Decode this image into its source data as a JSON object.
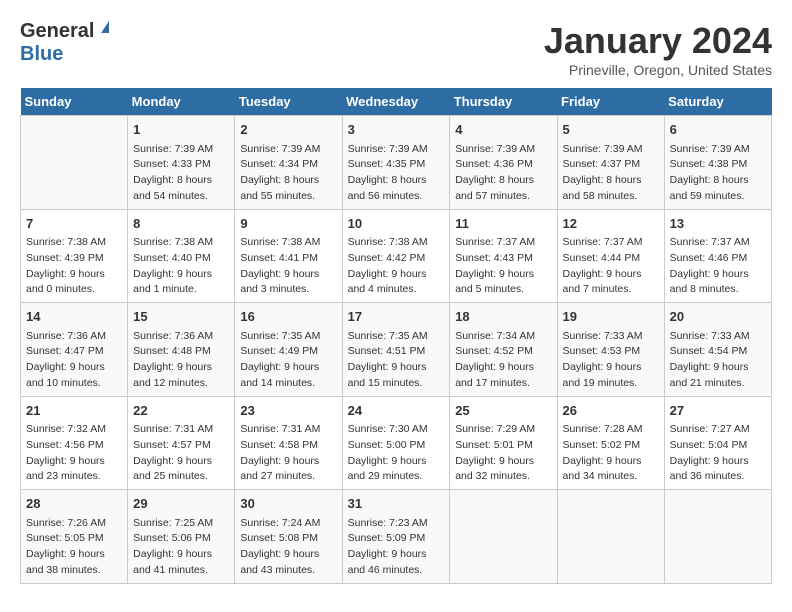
{
  "header": {
    "logo_general": "General",
    "logo_blue": "Blue",
    "month": "January 2024",
    "location": "Prineville, Oregon, United States"
  },
  "days_of_week": [
    "Sunday",
    "Monday",
    "Tuesday",
    "Wednesday",
    "Thursday",
    "Friday",
    "Saturday"
  ],
  "weeks": [
    [
      {
        "day": "",
        "info": ""
      },
      {
        "day": "1",
        "info": "Sunrise: 7:39 AM\nSunset: 4:33 PM\nDaylight: 8 hours\nand 54 minutes."
      },
      {
        "day": "2",
        "info": "Sunrise: 7:39 AM\nSunset: 4:34 PM\nDaylight: 8 hours\nand 55 minutes."
      },
      {
        "day": "3",
        "info": "Sunrise: 7:39 AM\nSunset: 4:35 PM\nDaylight: 8 hours\nand 56 minutes."
      },
      {
        "day": "4",
        "info": "Sunrise: 7:39 AM\nSunset: 4:36 PM\nDaylight: 8 hours\nand 57 minutes."
      },
      {
        "day": "5",
        "info": "Sunrise: 7:39 AM\nSunset: 4:37 PM\nDaylight: 8 hours\nand 58 minutes."
      },
      {
        "day": "6",
        "info": "Sunrise: 7:39 AM\nSunset: 4:38 PM\nDaylight: 8 hours\nand 59 minutes."
      }
    ],
    [
      {
        "day": "7",
        "info": "Sunrise: 7:38 AM\nSunset: 4:39 PM\nDaylight: 9 hours\nand 0 minutes."
      },
      {
        "day": "8",
        "info": "Sunrise: 7:38 AM\nSunset: 4:40 PM\nDaylight: 9 hours\nand 1 minute."
      },
      {
        "day": "9",
        "info": "Sunrise: 7:38 AM\nSunset: 4:41 PM\nDaylight: 9 hours\nand 3 minutes."
      },
      {
        "day": "10",
        "info": "Sunrise: 7:38 AM\nSunset: 4:42 PM\nDaylight: 9 hours\nand 4 minutes."
      },
      {
        "day": "11",
        "info": "Sunrise: 7:37 AM\nSunset: 4:43 PM\nDaylight: 9 hours\nand 5 minutes."
      },
      {
        "day": "12",
        "info": "Sunrise: 7:37 AM\nSunset: 4:44 PM\nDaylight: 9 hours\nand 7 minutes."
      },
      {
        "day": "13",
        "info": "Sunrise: 7:37 AM\nSunset: 4:46 PM\nDaylight: 9 hours\nand 8 minutes."
      }
    ],
    [
      {
        "day": "14",
        "info": "Sunrise: 7:36 AM\nSunset: 4:47 PM\nDaylight: 9 hours\nand 10 minutes."
      },
      {
        "day": "15",
        "info": "Sunrise: 7:36 AM\nSunset: 4:48 PM\nDaylight: 9 hours\nand 12 minutes."
      },
      {
        "day": "16",
        "info": "Sunrise: 7:35 AM\nSunset: 4:49 PM\nDaylight: 9 hours\nand 14 minutes."
      },
      {
        "day": "17",
        "info": "Sunrise: 7:35 AM\nSunset: 4:51 PM\nDaylight: 9 hours\nand 15 minutes."
      },
      {
        "day": "18",
        "info": "Sunrise: 7:34 AM\nSunset: 4:52 PM\nDaylight: 9 hours\nand 17 minutes."
      },
      {
        "day": "19",
        "info": "Sunrise: 7:33 AM\nSunset: 4:53 PM\nDaylight: 9 hours\nand 19 minutes."
      },
      {
        "day": "20",
        "info": "Sunrise: 7:33 AM\nSunset: 4:54 PM\nDaylight: 9 hours\nand 21 minutes."
      }
    ],
    [
      {
        "day": "21",
        "info": "Sunrise: 7:32 AM\nSunset: 4:56 PM\nDaylight: 9 hours\nand 23 minutes."
      },
      {
        "day": "22",
        "info": "Sunrise: 7:31 AM\nSunset: 4:57 PM\nDaylight: 9 hours\nand 25 minutes."
      },
      {
        "day": "23",
        "info": "Sunrise: 7:31 AM\nSunset: 4:58 PM\nDaylight: 9 hours\nand 27 minutes."
      },
      {
        "day": "24",
        "info": "Sunrise: 7:30 AM\nSunset: 5:00 PM\nDaylight: 9 hours\nand 29 minutes."
      },
      {
        "day": "25",
        "info": "Sunrise: 7:29 AM\nSunset: 5:01 PM\nDaylight: 9 hours\nand 32 minutes."
      },
      {
        "day": "26",
        "info": "Sunrise: 7:28 AM\nSunset: 5:02 PM\nDaylight: 9 hours\nand 34 minutes."
      },
      {
        "day": "27",
        "info": "Sunrise: 7:27 AM\nSunset: 5:04 PM\nDaylight: 9 hours\nand 36 minutes."
      }
    ],
    [
      {
        "day": "28",
        "info": "Sunrise: 7:26 AM\nSunset: 5:05 PM\nDaylight: 9 hours\nand 38 minutes."
      },
      {
        "day": "29",
        "info": "Sunrise: 7:25 AM\nSunset: 5:06 PM\nDaylight: 9 hours\nand 41 minutes."
      },
      {
        "day": "30",
        "info": "Sunrise: 7:24 AM\nSunset: 5:08 PM\nDaylight: 9 hours\nand 43 minutes."
      },
      {
        "day": "31",
        "info": "Sunrise: 7:23 AM\nSunset: 5:09 PM\nDaylight: 9 hours\nand 46 minutes."
      },
      {
        "day": "",
        "info": ""
      },
      {
        "day": "",
        "info": ""
      },
      {
        "day": "",
        "info": ""
      }
    ]
  ]
}
